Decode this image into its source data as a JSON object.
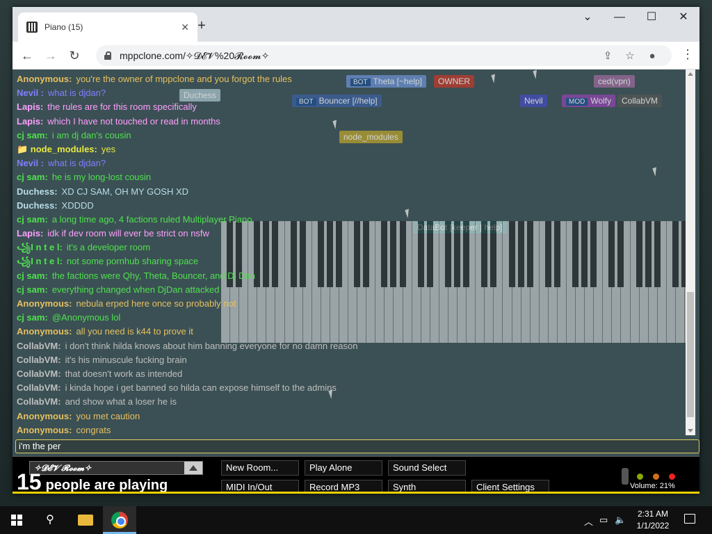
{
  "browser": {
    "tab_title": "Piano (15)",
    "tab_close": "✕",
    "new_tab": "+",
    "url": "mppclone.com/✧𝓓𝓔𝓥%20𝓡𝓸𝓸𝓶✧",
    "controls": {
      "minimize": "—",
      "maximize": "☐",
      "close": "✕",
      "dropdown": "⌄"
    }
  },
  "nametags": [
    {
      "text": "Duchess",
      "color": "#a8c0c8"
    },
    {
      "text": "Theta [~help]",
      "color": "#6b8fd0",
      "badge": "BOT"
    },
    {
      "text": "OWNER",
      "color": "#c0392b"
    },
    {
      "text": "Bouncer [//help]",
      "color": "#3b5fa0",
      "badge": "BOT"
    },
    {
      "text": "Nevil",
      "color": "#444dbb"
    },
    {
      "text": "Wolfy",
      "color": "#8e44ad",
      "badge": "MOD"
    },
    {
      "text": "CollabVM",
      "color": "#555"
    },
    {
      "text": "ced(vpn)",
      "color": "#9b6a9b"
    },
    {
      "text": "node_modules",
      "color": "#b9a12c"
    },
    {
      "text": "DataBot [keeper | help]",
      "color": "#2a7a7a"
    }
  ],
  "chat": [
    {
      "nick": "Anonymous:",
      "text": "you're the owner of mppclone and you forgot the rules",
      "color": "#e6c060"
    },
    {
      "nick": "Nevil :",
      "text": "what is djdan?",
      "color": "#7f7fff"
    },
    {
      "nick": "Lapis:",
      "text": "the rules are for this room specifically",
      "color": "#ff9fff"
    },
    {
      "nick": "Lapis:",
      "text": "which I have not touched or read in months",
      "color": "#ff9fff"
    },
    {
      "nick": "cj sam:",
      "text": "i am dj dan's cousin",
      "color": "#50e050"
    },
    {
      "nick": "📁 node_modules:",
      "text": "yes",
      "color": "#e8e840"
    },
    {
      "nick": "Nevil :",
      "text": "what is djdan?",
      "color": "#7f7fff"
    },
    {
      "nick": "cj sam:",
      "text": "he is my long-lost cousin",
      "color": "#50e050"
    },
    {
      "nick": "Duchess:",
      "text": "XD CJ SAM, OH MY GOSH XD",
      "color": "#b8dce8"
    },
    {
      "nick": "Duchess:",
      "text": "XDDDD",
      "color": "#b8dce8"
    },
    {
      "nick": "cj sam:",
      "text": "a long time ago, 4 factions ruled Multiplayer Piano",
      "color": "#50e050"
    },
    {
      "nick": "Lapis:",
      "text": "idk if dev room will ever be strict on nsfw",
      "color": "#ff9fff"
    },
    {
      "nick": "꧁I n t e l:",
      "text": "it's a developer room",
      "color": "#50e050"
    },
    {
      "nick": "꧁I n t e l:",
      "text": "not some pornhub sharing space",
      "color": "#50e050"
    },
    {
      "nick": "cj sam:",
      "text": "the factions were Qhy, Theta, Bouncer, and Dj Dan",
      "color": "#50e050"
    },
    {
      "nick": "cj sam:",
      "text": "everything changed when DjDan attacked",
      "color": "#50e050"
    },
    {
      "nick": "Anonymous:",
      "text": "nebula erped here once so probably not",
      "color": "#e6c060"
    },
    {
      "nick": "cj sam:",
      "text": "@Anonymous lol",
      "color": "#50e050"
    },
    {
      "nick": "Anonymous:",
      "text": "all you need is k44 to prove it",
      "color": "#e6c060"
    },
    {
      "nick": "CollabVM:",
      "text": "i don't think hilda knows about him banning everyone for no damn reason",
      "color": "#bfbfbf"
    },
    {
      "nick": "CollabVM:",
      "text": "it's his minuscule fucking brain",
      "color": "#bfbfbf"
    },
    {
      "nick": "CollabVM:",
      "text": "that doesn't work as intended",
      "color": "#bfbfbf"
    },
    {
      "nick": "CollabVM:",
      "text": "i kinda hope i get banned so hilda can expose himself to the admins",
      "color": "#bfbfbf"
    },
    {
      "nick": "CollabVM:",
      "text": "and show what a loser he is",
      "color": "#bfbfbf"
    },
    {
      "nick": "Anonymous:",
      "text": "you met caution",
      "color": "#e6c060"
    },
    {
      "nick": "Anonymous:",
      "text": "congrats",
      "color": "#e6c060"
    }
  ],
  "chat_input": {
    "value": "i'm the per"
  },
  "bottom": {
    "room_name": "✧𝓓𝓔𝓥 𝓡𝓸𝓸𝓶✧",
    "count": "15",
    "count_label": "people are playing",
    "buttons": {
      "new_room": "New Room...",
      "play_alone": "Play Alone",
      "sound_select": "Sound Select",
      "midi": "MIDI In/Out",
      "record": "Record MP3",
      "synth": "Synth",
      "client_settings": "Client Settings"
    },
    "volume": "Volume: 21%",
    "status_colors": [
      "#88aa00",
      "#d0701a",
      "#ee2222"
    ]
  },
  "taskbar": {
    "time": "2:31 AM",
    "date": "1/1/2022",
    "search_icon": "⚲"
  }
}
